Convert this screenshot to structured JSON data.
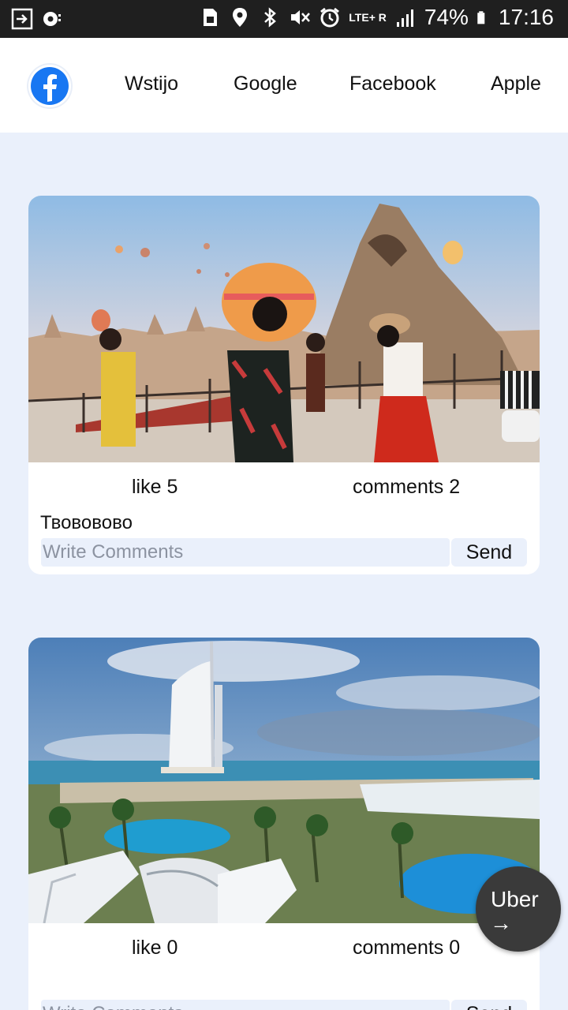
{
  "status_bar": {
    "battery": "74%",
    "time": "17:16",
    "network": "LTE+ R",
    "icons": [
      "screen-cast-icon",
      "voicemail-icon",
      "sim-icon",
      "location-icon",
      "bluetooth-icon",
      "mute-icon",
      "alarm-icon",
      "signal-icon",
      "battery-icon"
    ]
  },
  "nav": {
    "logo": "facebook-logo",
    "links": [
      "Wstijo",
      "Google",
      "Facebook",
      "Apple"
    ]
  },
  "posts": [
    {
      "image": "cappadocia-balloons-photo",
      "likes": "like 5",
      "comments": "comments 2",
      "caption": "Твововово",
      "input_placeholder": "Write Comments",
      "send_label": "Send"
    },
    {
      "image": "dubai-burj-al-arab-photo",
      "likes": "like 0",
      "comments": "comments 0",
      "caption": "",
      "input_placeholder": "Write Comments",
      "send_label": "Send"
    }
  ],
  "fab": {
    "label": "Uber",
    "arrow": "→"
  },
  "colors": {
    "page_bg": "#eaf0fb",
    "status_bar_bg": "#1f1f1f",
    "facebook_blue": "#1877f2",
    "fab_bg": "#3a3a3a"
  }
}
